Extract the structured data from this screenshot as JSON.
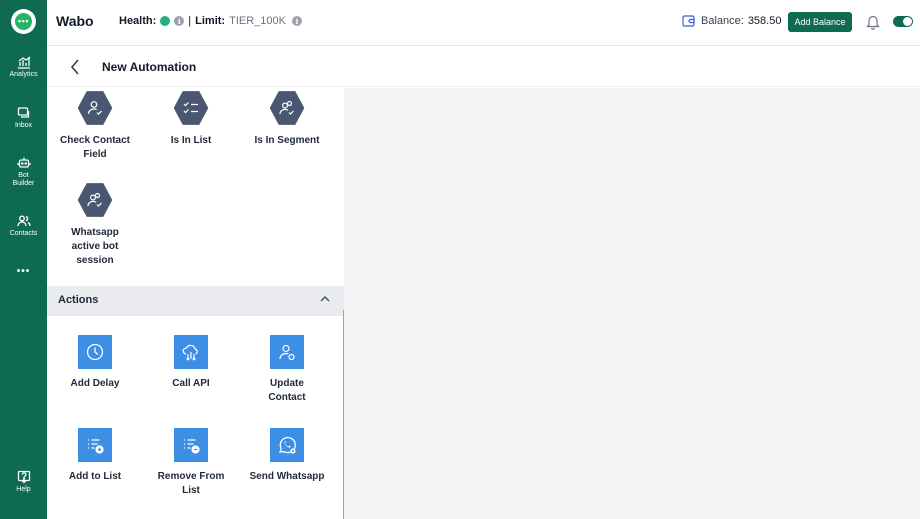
{
  "app": {
    "name": "Wabo"
  },
  "rail": {
    "items": [
      {
        "label": "Analytics",
        "icon": "chart-icon"
      },
      {
        "label": "Inbox",
        "icon": "inbox-icon"
      },
      {
        "label": "Bot Builder",
        "icon": "robot-icon"
      },
      {
        "label": "Contacts",
        "icon": "contacts-icon"
      },
      {
        "label": "•••",
        "icon": "more-icon"
      },
      {
        "label": "Help",
        "icon": "help-icon"
      }
    ]
  },
  "header": {
    "health_label": "Health:",
    "health_status_color": "#22b07d",
    "separator": "|",
    "limit_label": "Limit:",
    "limit_value": "TIER_100K",
    "balance_label": "Balance:",
    "balance_value": "358.50",
    "add_balance_label": "Add Balance"
  },
  "page": {
    "title": "New Automation"
  },
  "conditions": {
    "items": [
      {
        "label": "Check Contact Field",
        "icon": "contact-check-icon"
      },
      {
        "label": "Is In List",
        "icon": "checklist-icon"
      },
      {
        "label": "Is In Segment",
        "icon": "segment-icon"
      },
      {
        "label": "Whatsapp active bot session",
        "icon": "segment-icon"
      }
    ]
  },
  "actions": {
    "title": "Actions",
    "items": [
      {
        "label": "Add Delay",
        "icon": "clock-icon"
      },
      {
        "label": "Call API",
        "icon": "cloud-api-icon"
      },
      {
        "label": "Update Contact",
        "icon": "user-edit-icon"
      },
      {
        "label": "Add to List",
        "icon": "list-add-icon"
      },
      {
        "label": "Remove From List",
        "icon": "list-remove-icon"
      },
      {
        "label": "Send Whatsapp",
        "icon": "whatsapp-icon"
      }
    ]
  },
  "colors": {
    "brand": "#0e6b51",
    "condition_icon": "#4b5771",
    "action_icon": "#3d8fe6"
  }
}
